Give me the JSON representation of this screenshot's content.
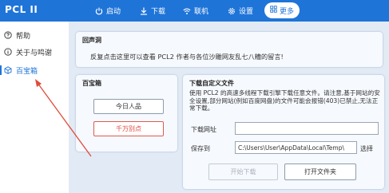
{
  "app": {
    "title": "PCL II"
  },
  "nav": [
    {
      "label": "启动",
      "icon": "power-icon"
    },
    {
      "label": "下载",
      "icon": "download-icon"
    },
    {
      "label": "联机",
      "icon": "wifi-icon"
    },
    {
      "label": "设置",
      "icon": "gear-icon"
    },
    {
      "label": "更多",
      "icon": "grid-icon",
      "active": true
    }
  ],
  "sidebar": {
    "items": [
      {
        "label": "帮助",
        "icon": "help-icon"
      },
      {
        "label": "关于与鸣谢",
        "icon": "info-icon"
      },
      {
        "label": "百宝箱",
        "icon": "cube-icon",
        "active": true
      }
    ]
  },
  "echo": {
    "title": "回声洞",
    "text": "反复点击这里可以查看 PCL2 作者与各位沙雕网友乱七八糟的留言!"
  },
  "toolbox": {
    "title": "百宝箱",
    "today_button": "今日人品",
    "danger_button": "千万别点"
  },
  "download": {
    "title": "下载自定义文件",
    "description": "使用 PCL2 的高速多线程下载引擎下载任意文件。请注意,基于网站的安全设置,部分网站(例如百度网盘)的文件可能会报错(403)已禁止,无法正常下载。",
    "url_label": "下载网址",
    "url_value": "",
    "save_label": "保存到",
    "save_value": "C:\\Users\\User\\AppData\\Local\\Temp\\",
    "choose_label": "选择",
    "start_button": "开始下载",
    "open_folder_button": "打开文件夹"
  },
  "colors": {
    "accent": "#1f74d8",
    "danger": "#e0483d",
    "arrow": "#e14b3b"
  }
}
